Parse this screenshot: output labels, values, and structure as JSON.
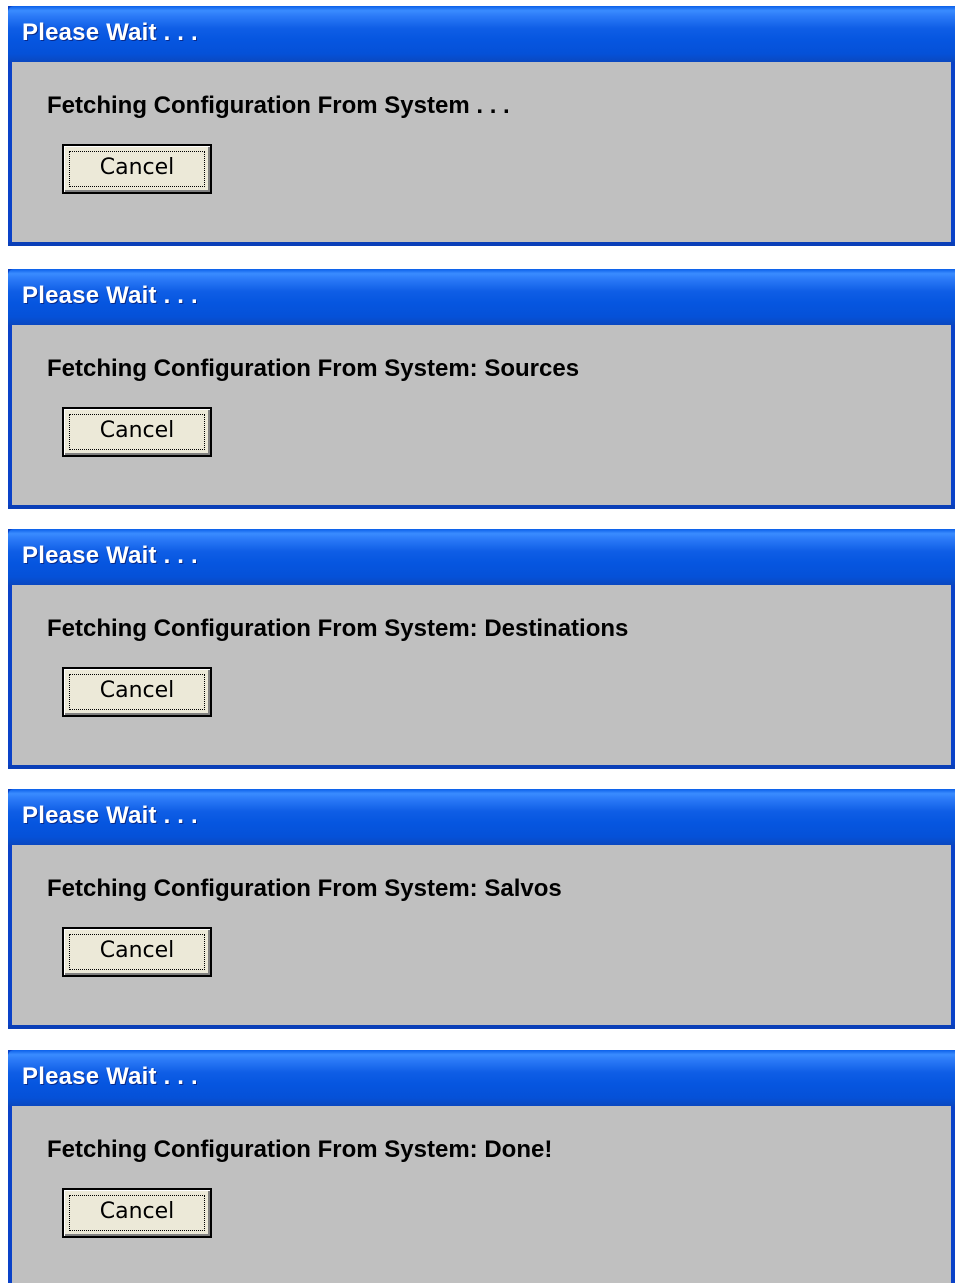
{
  "dialogs": [
    {
      "title": "Please Wait . . .",
      "message": "Fetching Configuration From System . . .",
      "cancel_label": "Cancel"
    },
    {
      "title": "Please Wait . . .",
      "message": "Fetching Configuration From System: Sources",
      "cancel_label": "Cancel"
    },
    {
      "title": "Please Wait . . .",
      "message": "Fetching Configuration From System: Destinations",
      "cancel_label": "Cancel"
    },
    {
      "title": "Please Wait . . .",
      "message": "Fetching Configuration From System: Salvos",
      "cancel_label": "Cancel"
    },
    {
      "title": "Please Wait . . .",
      "message": "Fetching Configuration From System: Done!",
      "cancel_label": "Cancel"
    }
  ],
  "colors": {
    "titlebar": "#0656e0",
    "client": "#c0c0c0",
    "button_face": "#ece9d8",
    "title_text": "#ffffff"
  }
}
